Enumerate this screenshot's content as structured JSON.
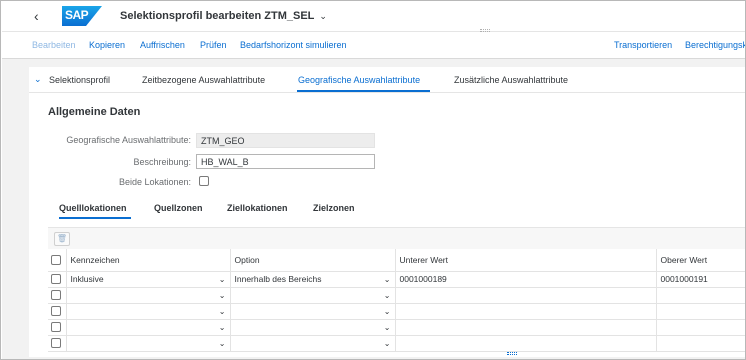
{
  "shell": {
    "back_glyph": "‹",
    "logo_text": "SAP",
    "title": "Selektionsprofil bearbeiten ZTM_SEL",
    "title_chevron": "⌄"
  },
  "toolbar": {
    "bearbeiten": "Bearbeiten",
    "kopieren": "Kopieren",
    "aktualisieren": "Auffrischen",
    "pruefen": "Prüfen",
    "bedarfshorizont": "Bedarfshorizont simulieren",
    "transportieren": "Transportieren",
    "berechtigung": "Berechtigungsk"
  },
  "tabs": {
    "collapse_glyph": "⌄",
    "t1": "Selektionsprofil",
    "t2": "Zeitbezogene Auswahlattribute",
    "t3": "Geografische Auswahlattribute",
    "t4": "Zusätzliche Auswahlattribute"
  },
  "section": {
    "title": "Allgemeine Daten",
    "geo_label": "Geografische Auswahlattribute:",
    "geo_value": "ZTM_GEO",
    "desc_label": "Beschreibung:",
    "desc_value": "HB_WAL_B",
    "beide_label": "Beide Lokationen:"
  },
  "subtabs": {
    "s1": "Quelllokationen",
    "s2": "Quellzonen",
    "s3": "Ziellokationen",
    "s4": "Zielzonen"
  },
  "table": {
    "delete_icon": "🗑",
    "headers": {
      "kennzeichen": "Kennzeichen",
      "option": "Option",
      "unterer": "Unterer Wert",
      "oberer": "Oberer Wert"
    },
    "rows": [
      {
        "kennzeichen": "Inklusive",
        "option": "Innerhalb des Bereichs",
        "unterer": "0001000189",
        "oberer": "0001000191"
      },
      {
        "kennzeichen": "",
        "option": "",
        "unterer": "",
        "oberer": ""
      },
      {
        "kennzeichen": "",
        "option": "",
        "unterer": "",
        "oberer": ""
      },
      {
        "kennzeichen": "",
        "option": "",
        "unterer": "",
        "oberer": ""
      },
      {
        "kennzeichen": "",
        "option": "",
        "unterer": "",
        "oberer": ""
      }
    ],
    "dropdown_glyph": "⌄"
  },
  "colors": {
    "accent": "#0a6ed1",
    "text": "#32363a",
    "label": "#6a6d70",
    "background": "#f2f2f2"
  }
}
